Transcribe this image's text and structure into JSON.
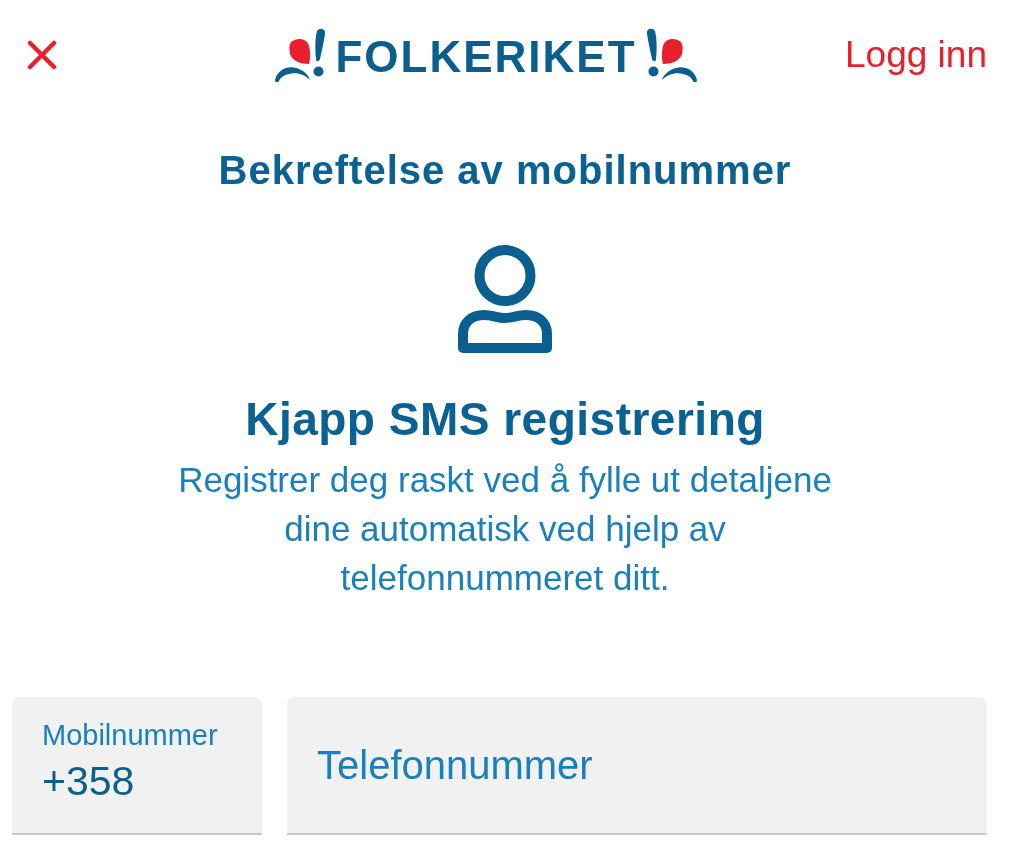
{
  "header": {
    "logo": "FOLKERIKET",
    "login_link": "Logg inn"
  },
  "title": "Bekreftelse av mobilnummer",
  "intro": {
    "heading": "Kjapp SMS registrering",
    "text": "Registrer deg raskt ved å fylle ut detaljene dine automatisk ved hjelp av telefonnummeret ditt."
  },
  "form": {
    "country_code": {
      "label": "Mobilnummer",
      "value": "+358"
    },
    "phone": {
      "placeholder": "Telefonnummer"
    }
  }
}
